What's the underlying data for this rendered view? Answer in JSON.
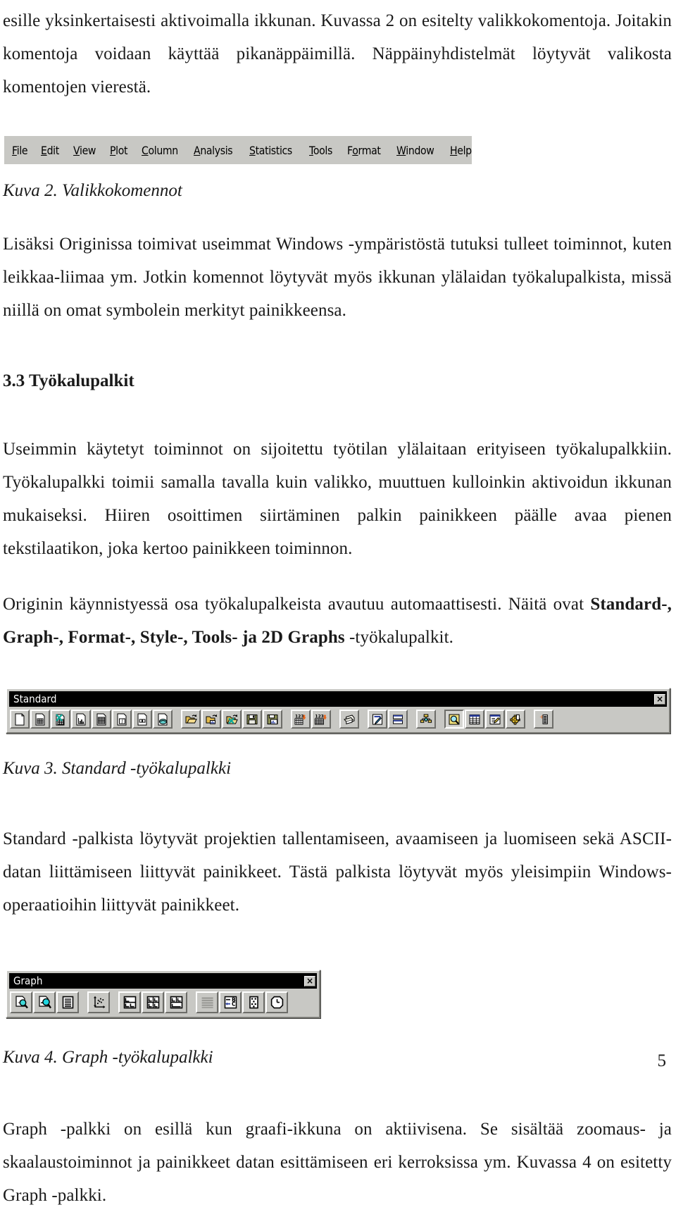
{
  "document": {
    "page_number": "5",
    "paragraphs": {
      "intro": "esille yksinkertaisesti aktivoimalla ikkunan. Kuvassa 2 on esitelty valikkokomentoja. Joitakin komentoja voidaan käyttää pikanäppäimillä. Näppäinyhdistelmät löytyvät valikosta komentojen vierestä.",
      "after_fig2": "Lisäksi Originissa toimivat useimmat Windows -ympäristöstä tutuksi tulleet toiminnot, kuten leikkaa-liimaa ym. Jotkin komennot löytyvät myös ikkunan ylälaidan työkalupalkista, missä niillä on omat symbolein merkityt painikkeensa.",
      "toolbars_1": "Useimmin käytetyt toiminnot on sijoitettu työtilan ylälaitaan erityiseen työkalupalkkiin. Työkalupalkki toimii samalla tavalla kuin valikko, muuttuen kulloinkin aktivoidun ikkunan mukaiseksi. Hiiren osoittimen siirtäminen palkin painikkeen päälle avaa pienen tekstilaatikon, joka kertoo painikkeen toiminnon.",
      "toolbars_2_pre": "Originin käynnistyessä osa työkalupalkeista avautuu automaattisesti. Näitä ovat ",
      "toolbars_2_bold": "Standard-, Graph-, Format-, Style-, Tools- ja 2D Graphs",
      "toolbars_2_post": " -työkalupalkit.",
      "standard_desc": "Standard -palkista löytyvät projektien tallentamiseen, avaamiseen ja luomiseen sekä ASCII-datan liittämiseen liittyvät painikkeet. Tästä palkista löytyvät myös yleisimpiin Windows-operaatioihin liittyvät painikkeet.",
      "graph_desc": "Graph -palkki on esillä kun graafi-ikkuna on aktiivisena. Se sisältää zoomaus- ja skaalaustoiminnot ja painikkeet datan esittämiseen eri kerroksissa ym. Kuvassa 4 on esitetty Graph -palkki."
    },
    "headings": {
      "toolbars": "3.3 Työkalupalkit"
    },
    "captions": {
      "fig2": "Kuva 2. Valikkokomennot",
      "fig3": "Kuva 3. Standard -työkalupalkki",
      "fig4": "Kuva 4. Graph -työkalupalkki"
    }
  },
  "menubar": {
    "items": [
      {
        "accel": "F",
        "rest": "ile"
      },
      {
        "accel": "E",
        "rest": "dit"
      },
      {
        "accel": "V",
        "rest": "iew"
      },
      {
        "accel": "P",
        "rest": "lot"
      },
      {
        "accel": "C",
        "rest": "olumn"
      },
      {
        "accel": "A",
        "rest": "nalysis"
      },
      {
        "accel": "S",
        "rest": "tatistics"
      },
      {
        "accel": "T",
        "rest": "ools"
      },
      {
        "pre": "F",
        "accel": "o",
        "rest": "rmat"
      },
      {
        "accel": "W",
        "rest": "indow"
      },
      {
        "accel": "H",
        "rest": "elp"
      }
    ]
  },
  "standard_toolbar": {
    "title": "Standard",
    "close_label": "×",
    "groups": [
      {
        "buttons": [
          {
            "name": "new-project-icon",
            "label": "New Project"
          },
          {
            "name": "new-worksheet-icon",
            "label": "New Worksheet"
          },
          {
            "name": "new-excel-icon",
            "label": "New Excel"
          },
          {
            "name": "new-graph-icon",
            "label": "New Graph"
          },
          {
            "name": "new-matrix-icon",
            "label": "New Matrix"
          },
          {
            "name": "new-function-icon",
            "label": "New Function Graph"
          },
          {
            "name": "new-layout-icon",
            "label": "New Layout Page"
          },
          {
            "name": "new-notes-icon",
            "label": "New Notes"
          }
        ]
      },
      {
        "buttons": [
          {
            "name": "open-project-icon",
            "label": "Open Project"
          },
          {
            "name": "open-template-icon",
            "label": "Open Template"
          },
          {
            "name": "open-excel-icon",
            "label": "Open Excel"
          },
          {
            "name": "save-project-icon",
            "label": "Save Project"
          },
          {
            "name": "save-template-icon",
            "label": "Save Template"
          }
        ]
      },
      {
        "buttons": [
          {
            "name": "import-ascii-icon",
            "label": "Import ASCII"
          },
          {
            "name": "import-multiple-ascii-icon",
            "label": "Import Multiple ASCII"
          }
        ]
      },
      {
        "buttons": [
          {
            "name": "print-icon",
            "label": "Print"
          }
        ]
      },
      {
        "buttons": [
          {
            "name": "edit-icon",
            "label": "Edit"
          },
          {
            "name": "copy-rows-icon",
            "label": "Copy"
          }
        ]
      },
      {
        "buttons": [
          {
            "name": "project-explorer-icon",
            "label": "Project Explorer"
          }
        ]
      },
      {
        "buttons": [
          {
            "name": "zoom-preview-icon",
            "label": "Print Preview",
            "pressed": true
          },
          {
            "name": "worksheet-view-icon",
            "label": "Worksheet"
          },
          {
            "name": "results-log-icon",
            "label": "Results Log"
          },
          {
            "name": "options-gear-icon",
            "label": "Options"
          }
        ]
      },
      {
        "buttons": [
          {
            "name": "layers-icon",
            "label": "Add Layer"
          }
        ]
      }
    ]
  },
  "graph_toolbar": {
    "title": "Graph",
    "close_label": "×",
    "groups": [
      {
        "buttons": [
          {
            "name": "zoom-in-icon",
            "label": "Zoom In"
          },
          {
            "name": "zoom-out-icon",
            "label": "Zoom Out"
          },
          {
            "name": "page-view-icon",
            "label": "Whole Page"
          }
        ]
      },
      {
        "buttons": [
          {
            "name": "rescale-axes-icon",
            "label": "Rescale to Show All"
          }
        ]
      },
      {
        "buttons": [
          {
            "name": "layer-arrange-icon",
            "label": "New Layer"
          },
          {
            "name": "layer-grid-4-icon",
            "label": "Arrange Layers"
          },
          {
            "name": "layer-grid-alt-icon",
            "label": "Extract Layers"
          }
        ]
      },
      {
        "buttons": [
          {
            "name": "stack-lines-icon",
            "label": "Stack Lines"
          },
          {
            "name": "merge-layers-icon",
            "label": "Merge Layers"
          },
          {
            "name": "data-selector-icon",
            "label": "Data Selector"
          },
          {
            "name": "clock-icon",
            "label": "Rotate"
          }
        ]
      }
    ]
  }
}
